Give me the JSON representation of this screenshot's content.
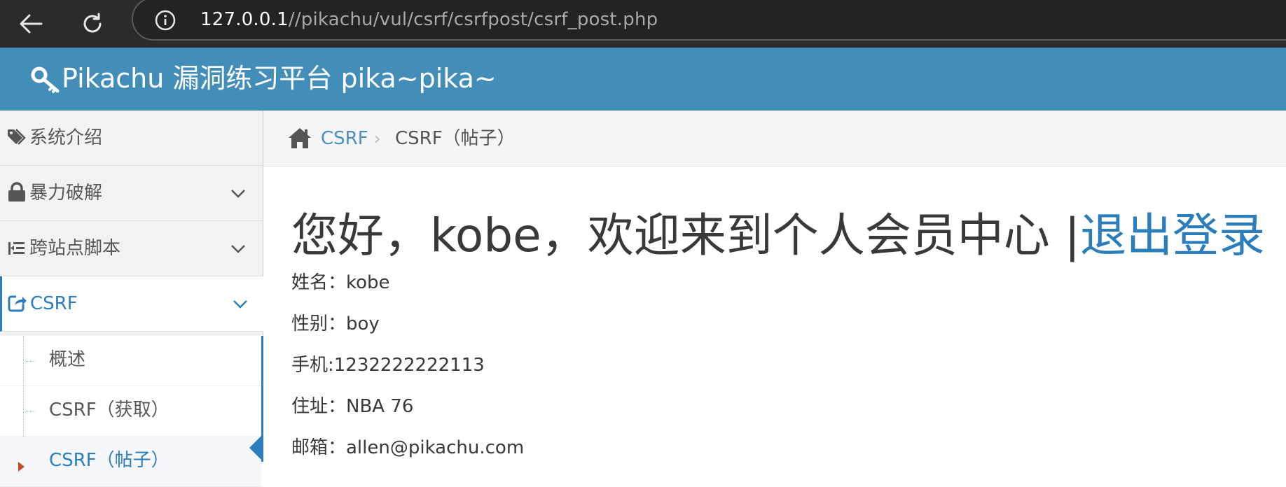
{
  "browser": {
    "url_host": "127.0.0.1",
    "url_path": "//pikachu/vul/csrf/csrfpost/csrf_post.php"
  },
  "header": {
    "brand": "Pikachu 漏洞练习平台 pika~pika~"
  },
  "sidebar": {
    "items": [
      {
        "label": "系统介绍",
        "icon": "tags-icon"
      },
      {
        "label": "暴力破解",
        "icon": "lock-icon"
      },
      {
        "label": "跨站点脚本",
        "icon": "indent-icon"
      },
      {
        "label": "CSRF",
        "icon": "share-square-icon"
      }
    ],
    "submenu": [
      {
        "label": "概述"
      },
      {
        "label": "CSRF（获取）"
      },
      {
        "label": "CSRF（帖子）"
      }
    ]
  },
  "breadcrumb": {
    "link": "CSRF",
    "separator": "›",
    "current": "CSRF（帖子）"
  },
  "main": {
    "welcome": "您好，kobe，欢迎来到个人会员中心 |",
    "logout": "退出登录",
    "fields": [
      "姓名：kobe",
      "性别：boy",
      "手机:1232222222113",
      "住址：NBA 76",
      "邮箱：allen@pikachu.com"
    ]
  },
  "colors": {
    "header_bg": "#438eb9",
    "link": "#2b7dbc",
    "sidebar_bg": "#f2f2f2"
  }
}
